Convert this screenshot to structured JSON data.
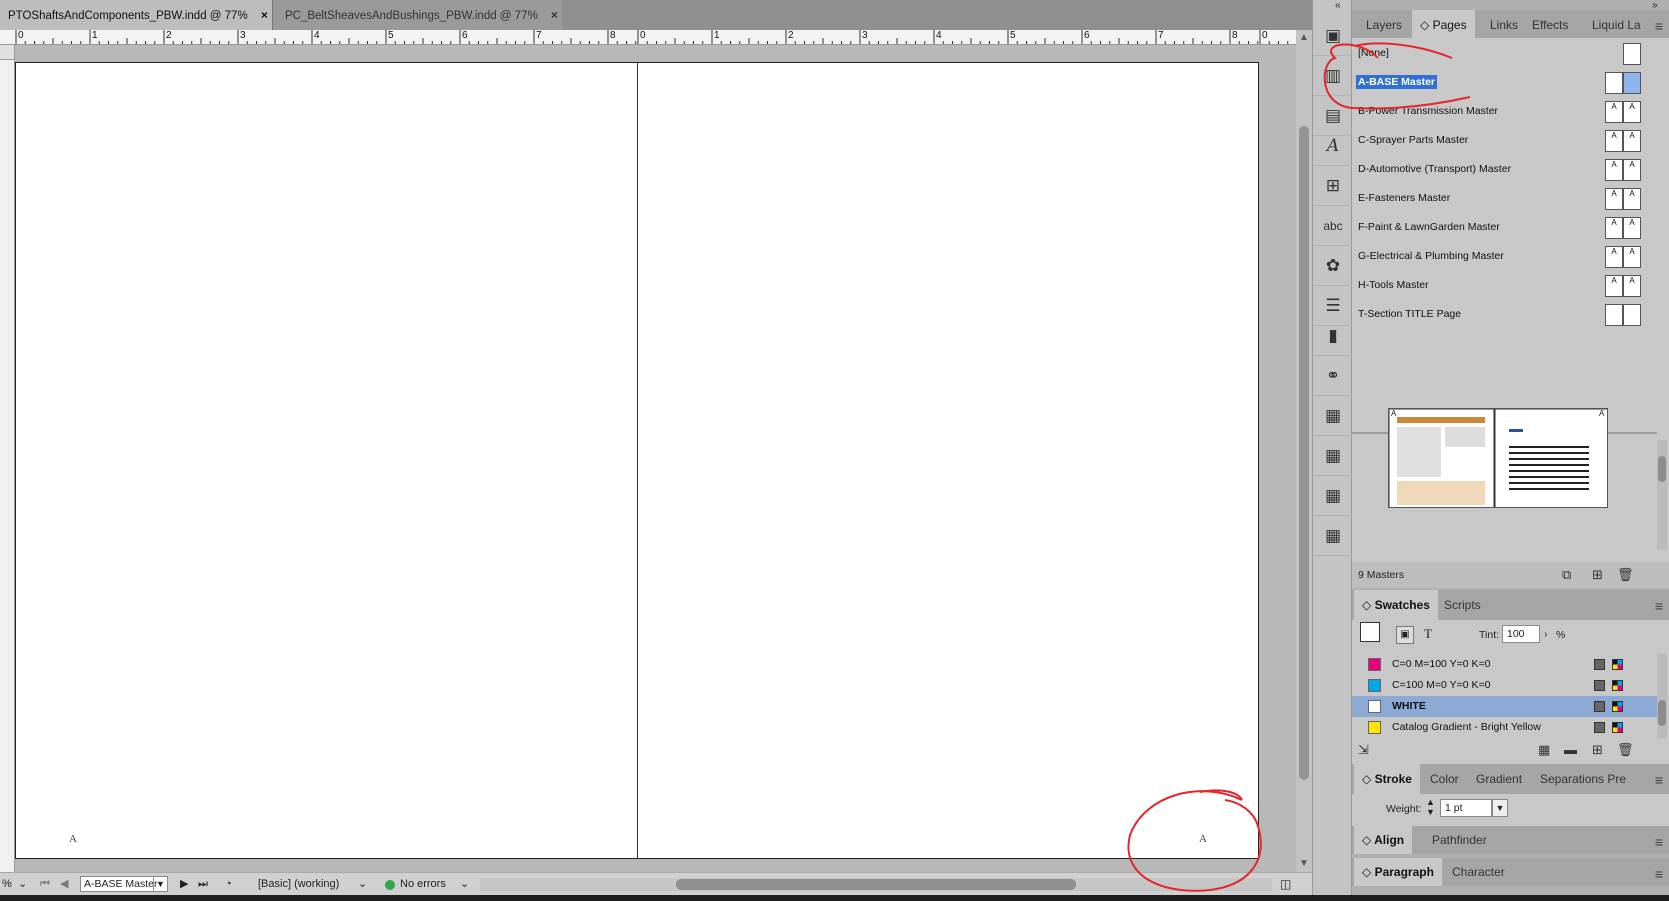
{
  "document_tabs": [
    {
      "label": "PTOShaftsAndComponents_PBW.indd @ 77%",
      "active": true
    },
    {
      "label": "PC_BeltSheavesAndBushings_PBW.indd @ 77%",
      "active": false
    }
  ],
  "tab_close_glyph": "×",
  "ruler_numbers": [
    "0",
    "1",
    "2",
    "3",
    "4",
    "5",
    "6",
    "7",
    "8",
    "0",
    "1",
    "2",
    "3",
    "4",
    "5",
    "6",
    "7",
    "8",
    "0"
  ],
  "spread": {
    "left_page_label": "A",
    "right_page_label": "A"
  },
  "status_bar": {
    "zoom": "%",
    "current_page": "A-BASE Master",
    "preflight_profile": "[Basic] (working)",
    "preflight_status": "No errors",
    "preflight_status_color": "#2ea84a"
  },
  "icon_strip": [
    "pages-icon",
    "libraries-icon",
    "libraries-icon-2",
    "character-styles-icon",
    "cc-libraries-icon",
    "spelling-icon",
    "object-styles-icon",
    "table-styles-icon",
    "bookmark-icon",
    "hyperlinks-icon",
    "table-icon",
    "table-icon-2",
    "table-icon-3",
    "table-icon-4"
  ],
  "pages_panel": {
    "tabs": [
      "Layers",
      "◇ Pages",
      "Links",
      "Effects",
      "Liquid La"
    ],
    "active_tab": "◇ Pages",
    "masters": [
      {
        "name": "[None]",
        "thumb": "single",
        "left": "",
        "right": "",
        "selected": false
      },
      {
        "name": "A-BASE Master",
        "thumb": "spread",
        "left": "",
        "right": "",
        "selected": true
      },
      {
        "name": "B-Power Transmission Master",
        "thumb": "spread",
        "left": "A",
        "right": "A",
        "selected": false
      },
      {
        "name": "C-Sprayer Parts Master",
        "thumb": "spread",
        "left": "A",
        "right": "A",
        "selected": false
      },
      {
        "name": "D-Automotive (Transport) Master",
        "thumb": "spread",
        "left": "A",
        "right": "A",
        "selected": false
      },
      {
        "name": "E-Fasteners Master",
        "thumb": "spread",
        "left": "A",
        "right": "A",
        "selected": false
      },
      {
        "name": "F-Paint & LawnGarden Master",
        "thumb": "spread",
        "left": "A",
        "right": "A",
        "selected": false
      },
      {
        "name": "G-Electrical & Plumbing Master",
        "thumb": "spread",
        "left": "A",
        "right": "A",
        "selected": false
      },
      {
        "name": "H-Tools Master",
        "thumb": "spread",
        "left": "A",
        "right": "A",
        "selected": false
      },
      {
        "name": "T-Section TITLE Page",
        "thumb": "spread",
        "left": "",
        "right": "",
        "selected": false
      }
    ],
    "page_thumb_labels": {
      "left": "A",
      "right": "A"
    },
    "footer_count": "9 Masters"
  },
  "swatches_panel": {
    "tabs": [
      "◇ Swatches",
      "Scripts"
    ],
    "tint_label": "Tint:",
    "tint_value": "100",
    "tint_unit": "%",
    "text_glyph": "T",
    "swatches": [
      {
        "name": "C=0 M=100 Y=0 K=0",
        "color": "#e4007c",
        "selected": false
      },
      {
        "name": "C=100 M=0 Y=0 K=0",
        "color": "#00a7e6",
        "selected": false
      },
      {
        "name": "WHITE",
        "color": "#ffffff",
        "selected": true
      },
      {
        "name": "Catalog Gradient - Bright Yellow",
        "color": "#ffe600",
        "selected": false
      }
    ]
  },
  "stroke_panel": {
    "tabs": [
      "◇ Stroke",
      "Color",
      "Gradient",
      "Separations Pre"
    ],
    "weight_label": "Weight:",
    "weight_value": "1 pt"
  },
  "align_panel": {
    "tabs": [
      "◇ Align",
      "Pathfinder"
    ]
  },
  "paragraph_panel": {
    "tabs": [
      "◇ Paragraph",
      "Character"
    ]
  }
}
